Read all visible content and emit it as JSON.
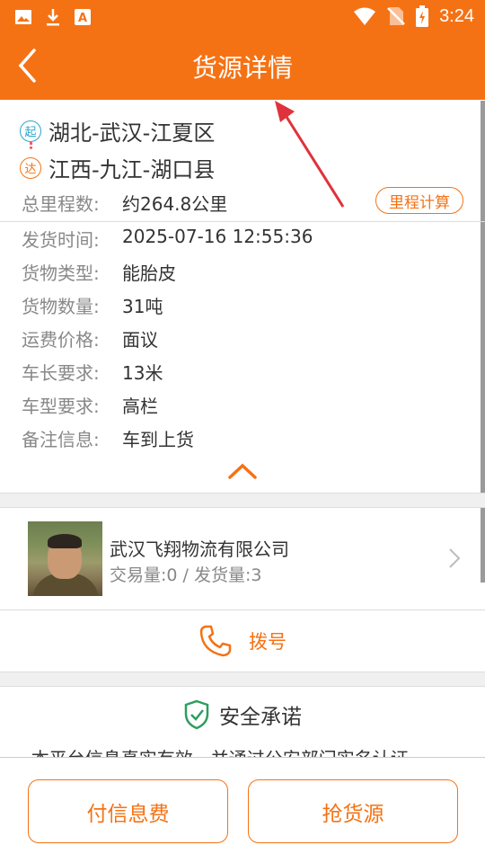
{
  "status_bar": {
    "time": "3:24",
    "left_icons": [
      "image-icon",
      "download-icon",
      "text-a-icon"
    ],
    "right_icons": [
      "wifi-icon",
      "no-sim-icon",
      "battery-charging-icon"
    ]
  },
  "header": {
    "title": "货源详情",
    "back_icon": "chevron-left-icon"
  },
  "route": {
    "start_badge": "起",
    "start_place": "湖北-武汉-江夏区",
    "end_badge": "达",
    "end_place": "江西-九江-湖口县"
  },
  "mileage": {
    "label": "总里程数:",
    "value": "约264.8公里",
    "button_label": "里程计算"
  },
  "details": [
    {
      "label": "发货时间:",
      "value": "2025-07-16 12:55:36"
    },
    {
      "label": "货物类型:",
      "value": "能胎皮"
    },
    {
      "label": "货物数量:",
      "value": "31吨"
    },
    {
      "label": "运费价格:",
      "value": "面议"
    },
    {
      "label": "车长要求:",
      "value": "13米"
    },
    {
      "label": "车型要求:",
      "value": "高栏"
    },
    {
      "label": "备注信息:",
      "value": "车到上货"
    }
  ],
  "company": {
    "name": "武汉飞翔物流有限公司",
    "stats": "交易量:0 / 发货量:3"
  },
  "dial": {
    "label": "拨号"
  },
  "safety": {
    "title": "安全承诺",
    "desc": "· 本平台信息真实有效，并通过公安部门实名认证"
  },
  "footer": {
    "pay_label": "付信息费",
    "grab_label": "抢货源"
  },
  "colors": {
    "brand": "#f57214",
    "start_badge": "#2aa6c8",
    "annotation_arrow": "#e0323a",
    "safety_green": "#2e9e5e"
  }
}
